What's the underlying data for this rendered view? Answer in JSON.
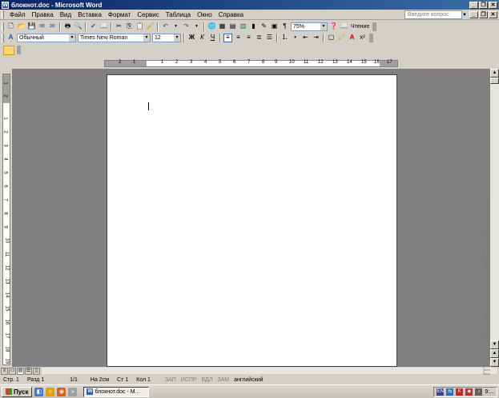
{
  "window": {
    "title": "блокнот.doc - Microsoft Word"
  },
  "menu": {
    "items": [
      "Файл",
      "Правка",
      "Вид",
      "Вставка",
      "Формат",
      "Сервис",
      "Таблица",
      "Окно",
      "Справка"
    ],
    "help_placeholder": "Введите вопрос"
  },
  "toolbar_standard": {
    "zoom": "75%",
    "reading_label": "Чтение"
  },
  "toolbar_formatting": {
    "style": "Обычный",
    "font": "Times New Roman",
    "size": "12",
    "bold": "Ж",
    "italic": "К",
    "underline": "Ч"
  },
  "ruler": {
    "h_numbers": [
      "2",
      "1",
      "1",
      "2",
      "3",
      "4",
      "5",
      "6",
      "7",
      "8",
      "9",
      "10",
      "11",
      "12",
      "13",
      "14",
      "15",
      "16",
      "17"
    ],
    "v_numbers": [
      "1",
      "2",
      "1",
      "2",
      "3",
      "4",
      "5",
      "6",
      "7",
      "8",
      "9",
      "10",
      "11",
      "12",
      "13",
      "14",
      "15",
      "16",
      "17",
      "18",
      "19"
    ]
  },
  "status": {
    "page": "Стр. 1",
    "section": "Разд 1",
    "pages": "1/1",
    "position": "На 2см",
    "line": "Ст 1",
    "column": "Кол 1",
    "rec": "ЗАП",
    "track": "ИСПР",
    "ext": "ВДЛ",
    "ovr": "ЗАМ",
    "language": "английский"
  },
  "taskbar": {
    "start": "Пуск",
    "task_item": "блокнот.doc - М...",
    "clock": "9:..."
  },
  "watermark": "manualcreation.livemaster.ru"
}
